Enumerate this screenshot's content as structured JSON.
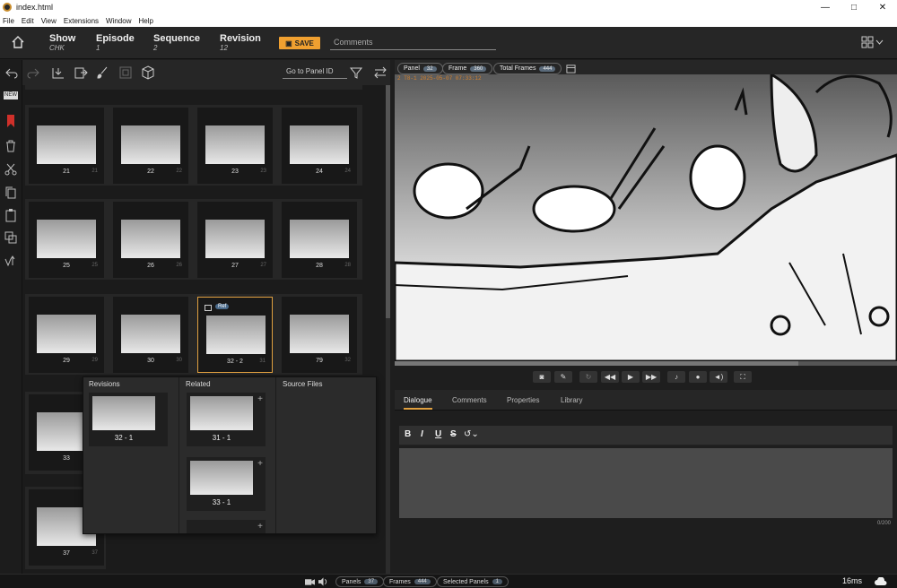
{
  "window": {
    "title": "index.html",
    "minimize": "—",
    "maximize": "□",
    "close": "✕"
  },
  "menu": [
    "File",
    "Edit",
    "View",
    "Extensions",
    "Window",
    "Help"
  ],
  "header": {
    "fields": [
      {
        "label": "Show",
        "value": "CHK"
      },
      {
        "label": "Episode",
        "value": "1"
      },
      {
        "label": "Sequence",
        "value": "2"
      },
      {
        "label": "Revision",
        "value": "12"
      }
    ],
    "save_label": "SAVE",
    "comments_placeholder": "Comments"
  },
  "grid_toolbar": {
    "goto_placeholder": "Go to Panel ID"
  },
  "panels": [
    {
      "num": "21",
      "dur": "21"
    },
    {
      "num": "22",
      "dur": "22"
    },
    {
      "num": "23",
      "dur": "23"
    },
    {
      "num": "24",
      "dur": "24"
    },
    {
      "num": "25",
      "dur": "25"
    },
    {
      "num": "26",
      "dur": "26"
    },
    {
      "num": "27",
      "dur": "27"
    },
    {
      "num": "28",
      "dur": "28"
    },
    {
      "num": "29",
      "dur": "29"
    },
    {
      "num": "30",
      "dur": "30"
    },
    {
      "num": "32 - 2",
      "dur": "31",
      "badge": "Ref"
    },
    {
      "num": "79",
      "dur": "32"
    },
    {
      "num": "33",
      "dur": "33"
    },
    {
      "num": "37",
      "dur": "37"
    }
  ],
  "popover": {
    "revisions_title": "Revisions",
    "related_title": "Related",
    "source_title": "Source Files",
    "revisions": [
      "32 - 1"
    ],
    "related": [
      "31 - 1",
      "33 - 1"
    ]
  },
  "viewer": {
    "panel_label": "Panel",
    "panel_count": "32",
    "frame_label": "Frame",
    "frame_count": "360",
    "total_label": "Total Frames",
    "total_count": "444",
    "timecode": "2 T8-1 2025-05-07 07:33:12"
  },
  "tabs": [
    "Dialogue",
    "Comments",
    "Properties",
    "Library"
  ],
  "editor": {
    "char_count": "0/200"
  },
  "status": {
    "panels_label": "Panels",
    "panels_count": "37",
    "frames_label": "Frames",
    "frames_count": "444",
    "selected_label": "Selected Panels",
    "selected_count": "1",
    "latency": "16ms"
  },
  "icons": [
    "home-icon",
    "grid-view-icon",
    "undo-icon",
    "redo-icon",
    "insert-panel-icon",
    "export-icon",
    "brush-icon",
    "cube-icon",
    "filter-icon",
    "swap-icon",
    "bookmark-icon",
    "trash-icon",
    "scissors-icon",
    "copy-icon",
    "paste-icon",
    "duplicate-icon",
    "version-icon",
    "calendar-icon",
    "camera-icon",
    "volume-icon",
    "cloud-icon"
  ]
}
